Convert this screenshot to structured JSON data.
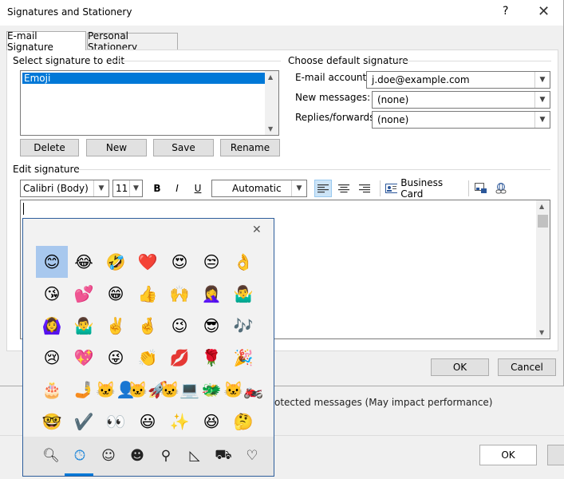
{
  "background": {
    "partial_text": "otected messages (May impact performance)",
    "ok_label": "OK"
  },
  "dialog": {
    "title": "Signatures and Stationery",
    "help": "?",
    "close": "✕",
    "tabs": [
      {
        "label": "E-mail Signature"
      },
      {
        "label": "Personal Stationery"
      }
    ],
    "select_label": "Select signature to edit",
    "signatures": [
      "Emoji"
    ],
    "buttons": {
      "delete": "Delete",
      "new": "New",
      "save": "Save",
      "rename": "Rename"
    },
    "default_group": "Choose default signature",
    "email_account_label": "E-mail account:",
    "email_account_value": "j.doe@example.com",
    "new_messages_label": "New messages:",
    "new_messages_value": "(none)",
    "replies_label": "Replies/forwards:",
    "replies_value": "(none)",
    "edit_label": "Edit signature",
    "font": "Calibri (Body)",
    "size": "11",
    "bold": "B",
    "italic": "I",
    "underline": "U",
    "color": "Automatic",
    "business_card": "Business Card",
    "ok": "OK",
    "cancel": "Cancel"
  },
  "emoji_panel": {
    "close": "✕",
    "emojis": [
      [
        "😊",
        "😂",
        "🤣",
        "❤️",
        "😍",
        "😒",
        "👌"
      ],
      [
        "😘",
        "💕",
        "😁",
        "👍",
        "🙌",
        "🤦‍♀️",
        "🤷‍♂️"
      ],
      [
        "🙆‍♀️",
        "🤷‍♂️",
        "✌️",
        "🤞",
        "😉",
        "😎",
        "🎶"
      ],
      [
        "😢",
        "💖",
        "😜",
        "👏",
        "💋",
        "🌹",
        "🎉"
      ],
      [
        "🎂",
        "🤳",
        "🐱‍👤",
        "🐱‍🚀",
        "🐱‍💻",
        "🐲",
        "🐱‍🏍"
      ],
      [
        "🤓",
        "✔️",
        "👀",
        "😃",
        "✨",
        "😆",
        "🤔"
      ]
    ],
    "tab_icons": [
      "search-icon",
      "clock-icon",
      "smiley-icon",
      "person-icon",
      "location-icon",
      "pizza-icon",
      "car-icon",
      "heart-icon"
    ],
    "tab_glyphs": [
      "🔍︎",
      "🕒︎",
      "☺︎",
      "☻︎",
      "⚲",
      "◺",
      "⛟",
      "♡"
    ]
  }
}
